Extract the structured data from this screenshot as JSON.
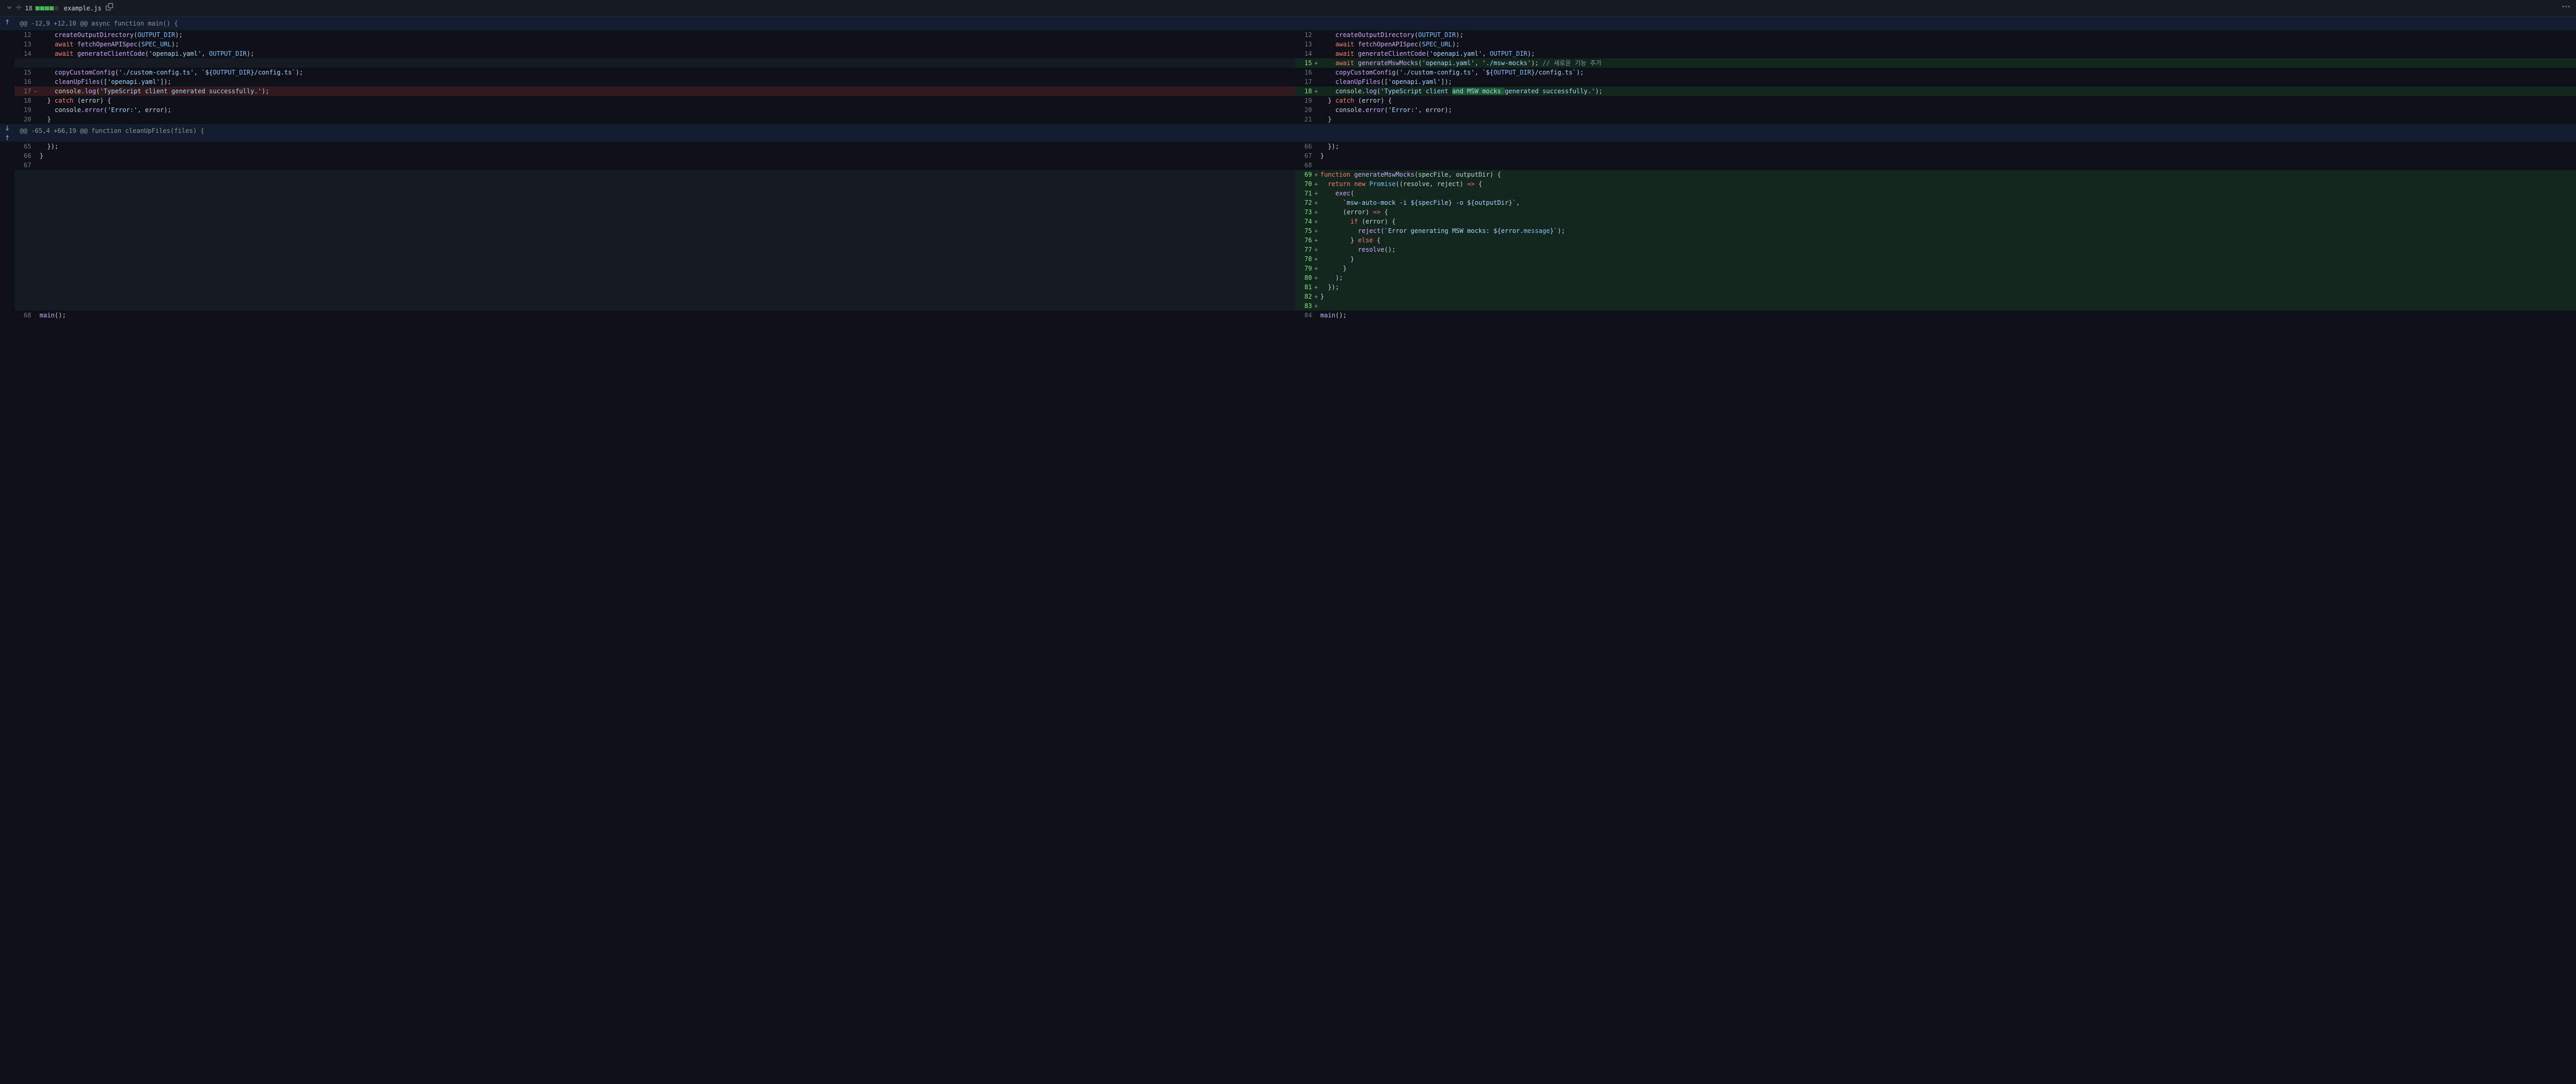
{
  "file": {
    "name": "example.js",
    "changes_count": "18",
    "add_bars": 4,
    "neutral_bars": 1
  },
  "hunks": [
    {
      "header": "@@ -12,9 +12,10 @@ async function main() {",
      "expand_single_up": true,
      "rows": [
        {
          "type": "ctx",
          "ln_l": "12",
          "ln_r": "12",
          "tokens_l": [
            {
              "t": "    ",
              "c": ""
            },
            {
              "t": "createOutputDirectory",
              "c": "fn"
            },
            {
              "t": "(",
              "c": ""
            },
            {
              "t": "OUTPUT_DIR",
              "c": "const"
            },
            {
              "t": ");",
              "c": ""
            }
          ],
          "tokens_r": [
            {
              "t": "    ",
              "c": ""
            },
            {
              "t": "createOutputDirectory",
              "c": "fn"
            },
            {
              "t": "(",
              "c": ""
            },
            {
              "t": "OUTPUT_DIR",
              "c": "const"
            },
            {
              "t": ");",
              "c": ""
            }
          ]
        },
        {
          "type": "ctx",
          "ln_l": "13",
          "ln_r": "13",
          "tokens_l": [
            {
              "t": "    ",
              "c": ""
            },
            {
              "t": "await",
              "c": "kw"
            },
            {
              "t": " ",
              "c": ""
            },
            {
              "t": "fetchOpenAPISpec",
              "c": "fn"
            },
            {
              "t": "(",
              "c": ""
            },
            {
              "t": "SPEC_URL",
              "c": "const"
            },
            {
              "t": ");",
              "c": ""
            }
          ],
          "tokens_r": [
            {
              "t": "    ",
              "c": ""
            },
            {
              "t": "await",
              "c": "kw"
            },
            {
              "t": " ",
              "c": ""
            },
            {
              "t": "fetchOpenAPISpec",
              "c": "fn"
            },
            {
              "t": "(",
              "c": ""
            },
            {
              "t": "SPEC_URL",
              "c": "const"
            },
            {
              "t": ");",
              "c": ""
            }
          ]
        },
        {
          "type": "ctx",
          "ln_l": "14",
          "ln_r": "14",
          "tokens_l": [
            {
              "t": "    ",
              "c": ""
            },
            {
              "t": "await",
              "c": "kw"
            },
            {
              "t": " ",
              "c": ""
            },
            {
              "t": "generateClientCode",
              "c": "fn"
            },
            {
              "t": "(",
              "c": ""
            },
            {
              "t": "'openapi.yaml'",
              "c": "str"
            },
            {
              "t": ", ",
              "c": ""
            },
            {
              "t": "OUTPUT_DIR",
              "c": "const"
            },
            {
              "t": ");",
              "c": ""
            }
          ],
          "tokens_r": [
            {
              "t": "    ",
              "c": ""
            },
            {
              "t": "await",
              "c": "kw"
            },
            {
              "t": " ",
              "c": ""
            },
            {
              "t": "generateClientCode",
              "c": "fn"
            },
            {
              "t": "(",
              "c": ""
            },
            {
              "t": "'openapi.yaml'",
              "c": "str"
            },
            {
              "t": ", ",
              "c": ""
            },
            {
              "t": "OUTPUT_DIR",
              "c": "const"
            },
            {
              "t": ");",
              "c": ""
            }
          ]
        },
        {
          "type": "add",
          "ln_r": "15",
          "tokens_r": [
            {
              "t": "    ",
              "c": ""
            },
            {
              "t": "await",
              "c": "kw"
            },
            {
              "t": " ",
              "c": ""
            },
            {
              "t": "generateMswMocks",
              "c": "fn"
            },
            {
              "t": "(",
              "c": ""
            },
            {
              "t": "'openapi.yaml'",
              "c": "str"
            },
            {
              "t": ", ",
              "c": ""
            },
            {
              "t": "'./msw-mocks'",
              "c": "str"
            },
            {
              "t": "); ",
              "c": ""
            },
            {
              "t": "// 새로운 기능 추가",
              "c": "comment"
            }
          ]
        },
        {
          "type": "ctx",
          "ln_l": "15",
          "ln_r": "16",
          "tokens_l": [
            {
              "t": "    ",
              "c": ""
            },
            {
              "t": "copyCustomConfig",
              "c": "fn"
            },
            {
              "t": "(",
              "c": ""
            },
            {
              "t": "'./custom-config.ts'",
              "c": "str"
            },
            {
              "t": ", ",
              "c": ""
            },
            {
              "t": "`${",
              "c": "tmpl"
            },
            {
              "t": "OUTPUT_DIR",
              "c": "const"
            },
            {
              "t": "}/config.ts`",
              "c": "tmpl"
            },
            {
              "t": ");",
              "c": ""
            }
          ],
          "tokens_r": [
            {
              "t": "    ",
              "c": ""
            },
            {
              "t": "copyCustomConfig",
              "c": "fn"
            },
            {
              "t": "(",
              "c": ""
            },
            {
              "t": "'./custom-config.ts'",
              "c": "str"
            },
            {
              "t": ", ",
              "c": ""
            },
            {
              "t": "`${",
              "c": "tmpl"
            },
            {
              "t": "OUTPUT_DIR",
              "c": "const"
            },
            {
              "t": "}/config.ts`",
              "c": "tmpl"
            },
            {
              "t": ");",
              "c": ""
            }
          ]
        },
        {
          "type": "ctx",
          "ln_l": "16",
          "ln_r": "17",
          "tokens_l": [
            {
              "t": "    ",
              "c": ""
            },
            {
              "t": "cleanUpFiles",
              "c": "fn"
            },
            {
              "t": "([",
              "c": ""
            },
            {
              "t": "'openapi.yaml'",
              "c": "str"
            },
            {
              "t": "]);",
              "c": ""
            }
          ],
          "tokens_r": [
            {
              "t": "    ",
              "c": ""
            },
            {
              "t": "cleanUpFiles",
              "c": "fn"
            },
            {
              "t": "([",
              "c": ""
            },
            {
              "t": "'openapi.yaml'",
              "c": "str"
            },
            {
              "t": "]);",
              "c": ""
            }
          ]
        },
        {
          "type": "change",
          "ln_l": "17",
          "ln_r": "18",
          "tokens_l": [
            {
              "t": "    console.",
              "c": ""
            },
            {
              "t": "log",
              "c": "fn"
            },
            {
              "t": "(",
              "c": ""
            },
            {
              "t": "'TypeScript client generated successfully.'",
              "c": "str"
            },
            {
              "t": ");",
              "c": ""
            }
          ],
          "tokens_r": [
            {
              "t": "    console.",
              "c": ""
            },
            {
              "t": "log",
              "c": "fn"
            },
            {
              "t": "(",
              "c": ""
            },
            {
              "t": "'TypeScript client ",
              "c": "str"
            },
            {
              "t": "and MSW mocks ",
              "c": "str",
              "hl": true
            },
            {
              "t": "generated successfully.'",
              "c": "str"
            },
            {
              "t": ");",
              "c": ""
            }
          ]
        },
        {
          "type": "ctx",
          "ln_l": "18",
          "ln_r": "19",
          "tokens_l": [
            {
              "t": "  } ",
              "c": ""
            },
            {
              "t": "catch",
              "c": "kw"
            },
            {
              "t": " (error) {",
              "c": ""
            }
          ],
          "tokens_r": [
            {
              "t": "  } ",
              "c": ""
            },
            {
              "t": "catch",
              "c": "kw"
            },
            {
              "t": " (error) {",
              "c": ""
            }
          ]
        },
        {
          "type": "ctx",
          "ln_l": "19",
          "ln_r": "20",
          "tokens_l": [
            {
              "t": "    console.",
              "c": ""
            },
            {
              "t": "error",
              "c": "fn"
            },
            {
              "t": "(",
              "c": ""
            },
            {
              "t": "'Error:'",
              "c": "str"
            },
            {
              "t": ", error);",
              "c": ""
            }
          ],
          "tokens_r": [
            {
              "t": "    console.",
              "c": ""
            },
            {
              "t": "error",
              "c": "fn"
            },
            {
              "t": "(",
              "c": ""
            },
            {
              "t": "'Error:'",
              "c": "str"
            },
            {
              "t": ", error);",
              "c": ""
            }
          ]
        },
        {
          "type": "ctx",
          "ln_l": "20",
          "ln_r": "21",
          "tokens_l": [
            {
              "t": "  }",
              "c": ""
            }
          ],
          "tokens_r": [
            {
              "t": "  }",
              "c": ""
            }
          ]
        }
      ]
    },
    {
      "header": "@@ -65,4 +66,19 @@ function cleanUpFiles(files) {",
      "expand_both": true,
      "rows": [
        {
          "type": "ctx",
          "ln_l": "65",
          "ln_r": "66",
          "tokens_l": [
            {
              "t": "  });",
              "c": ""
            }
          ],
          "tokens_r": [
            {
              "t": "  });",
              "c": ""
            }
          ]
        },
        {
          "type": "ctx",
          "ln_l": "66",
          "ln_r": "67",
          "tokens_l": [
            {
              "t": "}",
              "c": ""
            }
          ],
          "tokens_r": [
            {
              "t": "}",
              "c": ""
            }
          ]
        },
        {
          "type": "ctx",
          "ln_l": "67",
          "ln_r": "68",
          "tokens_l": [
            {
              "t": "",
              "c": ""
            }
          ],
          "tokens_r": [
            {
              "t": "",
              "c": ""
            }
          ]
        },
        {
          "type": "add",
          "ln_r": "69",
          "tokens_r": [
            {
              "t": "function",
              "c": "kw"
            },
            {
              "t": " ",
              "c": ""
            },
            {
              "t": "generateMswMocks",
              "c": "fn"
            },
            {
              "t": "(specFile, outputDir) {",
              "c": ""
            }
          ]
        },
        {
          "type": "add",
          "ln_r": "70",
          "tokens_r": [
            {
              "t": "  ",
              "c": ""
            },
            {
              "t": "return",
              "c": "kw"
            },
            {
              "t": " ",
              "c": ""
            },
            {
              "t": "new",
              "c": "kw"
            },
            {
              "t": " ",
              "c": ""
            },
            {
              "t": "Promise",
              "c": "const"
            },
            {
              "t": "((resolve, reject) ",
              "c": ""
            },
            {
              "t": "=>",
              "c": "kw"
            },
            {
              "t": " {",
              "c": ""
            }
          ]
        },
        {
          "type": "add",
          "ln_r": "71",
          "tokens_r": [
            {
              "t": "    ",
              "c": ""
            },
            {
              "t": "exec",
              "c": "fn"
            },
            {
              "t": "(",
              "c": ""
            }
          ]
        },
        {
          "type": "add",
          "ln_r": "72",
          "tokens_r": [
            {
              "t": "      ",
              "c": ""
            },
            {
              "t": "`msw-auto-mock -i ${specFile} -o ${outputDir}`",
              "c": "tmpl"
            },
            {
              "t": ",",
              "c": ""
            }
          ]
        },
        {
          "type": "add",
          "ln_r": "73",
          "tokens_r": [
            {
              "t": "      (error) ",
              "c": ""
            },
            {
              "t": "=>",
              "c": "kw"
            },
            {
              "t": " {",
              "c": ""
            }
          ]
        },
        {
          "type": "add",
          "ln_r": "74",
          "tokens_r": [
            {
              "t": "        ",
              "c": ""
            },
            {
              "t": "if",
              "c": "kw"
            },
            {
              "t": " (error) {",
              "c": ""
            }
          ]
        },
        {
          "type": "add",
          "ln_r": "75",
          "tokens_r": [
            {
              "t": "          ",
              "c": ""
            },
            {
              "t": "reject",
              "c": "fn"
            },
            {
              "t": "(",
              "c": ""
            },
            {
              "t": "`Error generating MSW mocks: ${error.",
              "c": "tmpl"
            },
            {
              "t": "message",
              "c": "prop"
            },
            {
              "t": "}`",
              "c": "tmpl"
            },
            {
              "t": ");",
              "c": ""
            }
          ]
        },
        {
          "type": "add",
          "ln_r": "76",
          "tokens_r": [
            {
              "t": "        } ",
              "c": ""
            },
            {
              "t": "else",
              "c": "kw"
            },
            {
              "t": " {",
              "c": ""
            }
          ]
        },
        {
          "type": "add",
          "ln_r": "77",
          "tokens_r": [
            {
              "t": "          ",
              "c": ""
            },
            {
              "t": "resolve",
              "c": "fn"
            },
            {
              "t": "();",
              "c": ""
            }
          ]
        },
        {
          "type": "add",
          "ln_r": "78",
          "tokens_r": [
            {
              "t": "        }",
              "c": ""
            }
          ]
        },
        {
          "type": "add",
          "ln_r": "79",
          "tokens_r": [
            {
              "t": "      }",
              "c": ""
            }
          ]
        },
        {
          "type": "add",
          "ln_r": "80",
          "tokens_r": [
            {
              "t": "    );",
              "c": ""
            }
          ]
        },
        {
          "type": "add",
          "ln_r": "81",
          "tokens_r": [
            {
              "t": "  });",
              "c": ""
            }
          ]
        },
        {
          "type": "add",
          "ln_r": "82",
          "tokens_r": [
            {
              "t": "}",
              "c": ""
            }
          ]
        },
        {
          "type": "add",
          "ln_r": "83",
          "tokens_r": [
            {
              "t": "",
              "c": ""
            }
          ]
        },
        {
          "type": "ctx",
          "ln_l": "68",
          "ln_r": "84",
          "tokens_l": [
            {
              "t": "main",
              "c": "fn"
            },
            {
              "t": "();",
              "c": ""
            }
          ],
          "tokens_r": [
            {
              "t": "main",
              "c": "fn"
            },
            {
              "t": "();",
              "c": ""
            }
          ]
        }
      ]
    }
  ]
}
